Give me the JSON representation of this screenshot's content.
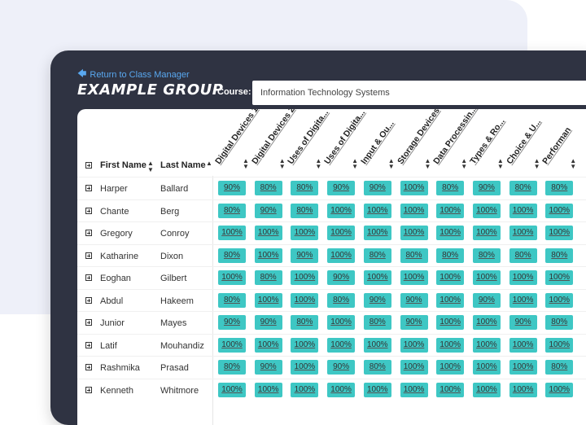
{
  "nav": {
    "back_label": "Return to Class Manager"
  },
  "group": {
    "title": "EXAMPLE GROUP"
  },
  "course": {
    "label": "Course:",
    "value": "Information Technology Systems"
  },
  "table": {
    "first_name_header": "First Name",
    "last_name_header": "Last Name",
    "columns": [
      "Digital Devices 1",
      "Digital Devices 2",
      "Uses of Digita...",
      "Uses of Digita...",
      "Input & Ou...",
      "Storage Devices",
      "Data Processin...",
      "Types & Ro...",
      "Choice & U...",
      "Performan"
    ],
    "rows": [
      {
        "first": "Harper",
        "last": "Ballard",
        "scores": [
          "90%",
          "80%",
          "80%",
          "90%",
          "90%",
          "100%",
          "80%",
          "90%",
          "80%",
          "80%"
        ]
      },
      {
        "first": "Chante",
        "last": "Berg",
        "scores": [
          "80%",
          "90%",
          "80%",
          "100%",
          "100%",
          "100%",
          "100%",
          "100%",
          "100%",
          "100%"
        ]
      },
      {
        "first": "Gregory",
        "last": "Conroy",
        "scores": [
          "100%",
          "100%",
          "100%",
          "100%",
          "100%",
          "100%",
          "100%",
          "100%",
          "100%",
          "100%"
        ]
      },
      {
        "first": "Katharine",
        "last": "Dixon",
        "scores": [
          "80%",
          "100%",
          "90%",
          "100%",
          "80%",
          "80%",
          "80%",
          "80%",
          "80%",
          "80%"
        ]
      },
      {
        "first": "Eoghan",
        "last": "Gilbert",
        "scores": [
          "100%",
          "80%",
          "100%",
          "90%",
          "100%",
          "100%",
          "100%",
          "100%",
          "100%",
          "100%"
        ]
      },
      {
        "first": "Abdul",
        "last": "Hakeem",
        "scores": [
          "80%",
          "100%",
          "100%",
          "80%",
          "90%",
          "90%",
          "100%",
          "90%",
          "100%",
          "100%"
        ]
      },
      {
        "first": "Junior",
        "last": "Mayes",
        "scores": [
          "90%",
          "90%",
          "80%",
          "100%",
          "80%",
          "90%",
          "100%",
          "100%",
          "90%",
          "80%"
        ]
      },
      {
        "first": "Latif",
        "last": "Mouhandiz",
        "scores": [
          "100%",
          "100%",
          "100%",
          "100%",
          "100%",
          "100%",
          "100%",
          "100%",
          "100%",
          "100%"
        ]
      },
      {
        "first": "Rashmika",
        "last": "Prasad",
        "scores": [
          "80%",
          "90%",
          "100%",
          "90%",
          "80%",
          "100%",
          "100%",
          "100%",
          "100%",
          "80%"
        ]
      },
      {
        "first": "Kenneth",
        "last": "Whitmore",
        "scores": [
          "100%",
          "100%",
          "100%",
          "100%",
          "100%",
          "100%",
          "100%",
          "100%",
          "100%",
          "100%"
        ]
      }
    ]
  },
  "colors": {
    "score_fill": "#3ec7c4",
    "app_bg": "#2f3342",
    "link": "#59a8f0"
  }
}
